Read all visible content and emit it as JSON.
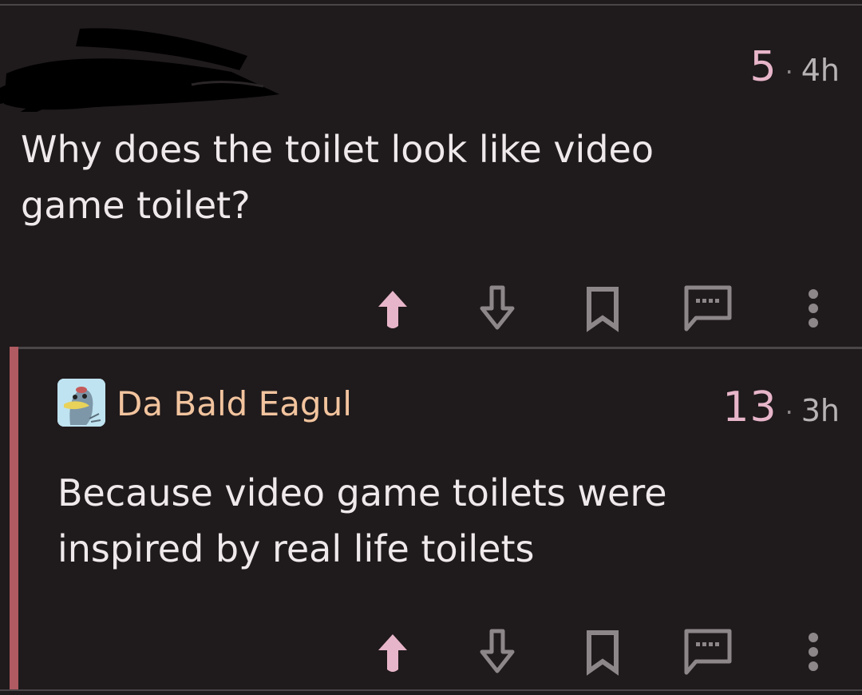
{
  "post": {
    "score": "5",
    "separator": "·",
    "age": "4h",
    "text_line1": "Why does the toilet look like video",
    "text_line2": "game toilet?"
  },
  "reply": {
    "username": "Da Bald Eagul",
    "score": "13",
    "separator": "·",
    "age": "3h",
    "text_line1": "Because video game toilets were",
    "text_line2": "inspired by real life toilets"
  },
  "icons": {
    "upvote": "arrow-up-icon",
    "downvote": "arrow-down-icon",
    "save": "bookmark-icon",
    "reply": "comment-icon",
    "more": "more-vertical-icon"
  },
  "colors": {
    "background": "#1f1a1c",
    "upvote_active": "#e7b5c9",
    "username": "#f2c49e",
    "thread_bar": "#b05a61",
    "icon_gray": "#8d8789",
    "text": "#efe9eb"
  }
}
